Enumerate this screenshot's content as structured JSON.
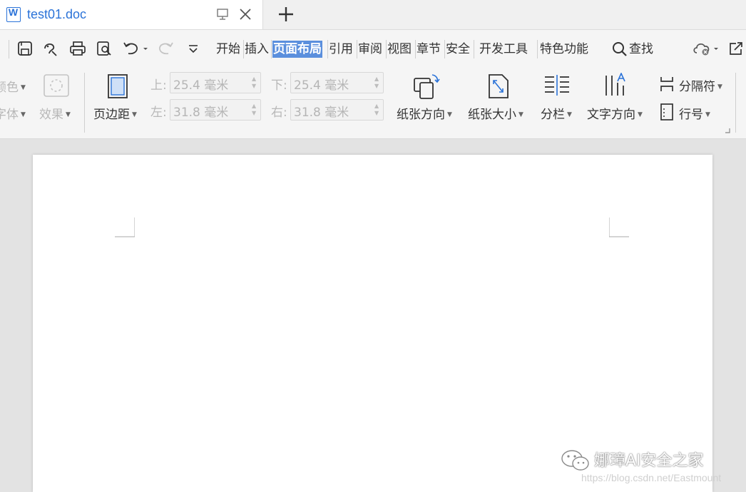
{
  "tab": {
    "title": "test01.doc",
    "icon": "wps-writer-icon",
    "new_tab_label": "+"
  },
  "menu": {
    "items": [
      "开始",
      "插入",
      "页面布局",
      "引用",
      "审阅",
      "视图",
      "章节",
      "安全",
      "开发工具",
      "特色功能"
    ],
    "active": "页面布局",
    "search_label": "查找"
  },
  "ribbon": {
    "color_label": "颜色",
    "font_label": "字体",
    "effect_label": "效果",
    "margins_label": "页边距",
    "top_label": "上:",
    "top_value": "25.4 毫米",
    "bottom_label": "下:",
    "bottom_value": "25.4 毫米",
    "left_label": "左:",
    "left_value": "31.8 毫米",
    "right_label": "右:",
    "right_value": "31.8 毫米",
    "orientation_label": "纸张方向",
    "size_label": "纸张大小",
    "columns_label": "分栏",
    "text_direction_label": "文字方向",
    "breaks_label": "分隔符",
    "line_numbers_label": "行号"
  },
  "watermark": {
    "title": "娜璋AI安全之家",
    "url": "https://blog.csdn.net/Eastmount"
  },
  "colors": {
    "accent": "#2b73d8",
    "active_menu_bg": "#5b8fdd",
    "ribbon_bg": "#f5f5f5",
    "workspace_bg": "#e3e3e3"
  }
}
